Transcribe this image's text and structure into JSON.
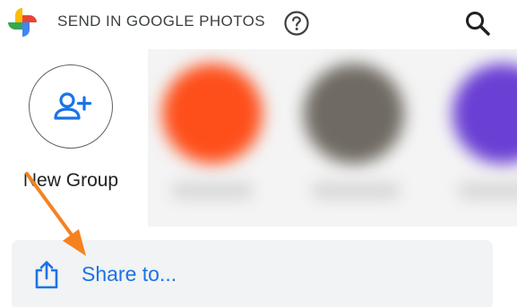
{
  "header": {
    "logo_icon": "google-photos-pinwheel-icon",
    "title": "SEND IN GOOGLE PHOTOS",
    "help_icon": "question-circle-icon",
    "search_icon": "search-icon"
  },
  "new_group": {
    "icon": "add-people-icon",
    "label": "New Group"
  },
  "contacts": [
    {
      "avatar_color": "#fe4f1b"
    },
    {
      "avatar_color": "#6f6a62"
    },
    {
      "avatar_color": "#6a3fd4"
    }
  ],
  "share": {
    "icon": "share-upload-icon",
    "label": "Share to..."
  },
  "annotation": {
    "type": "arrow",
    "color": "#f5821f"
  },
  "colors": {
    "accent": "#1a73e8",
    "share_row_bg": "#f1f3f4",
    "annotation": "#f5821f"
  }
}
